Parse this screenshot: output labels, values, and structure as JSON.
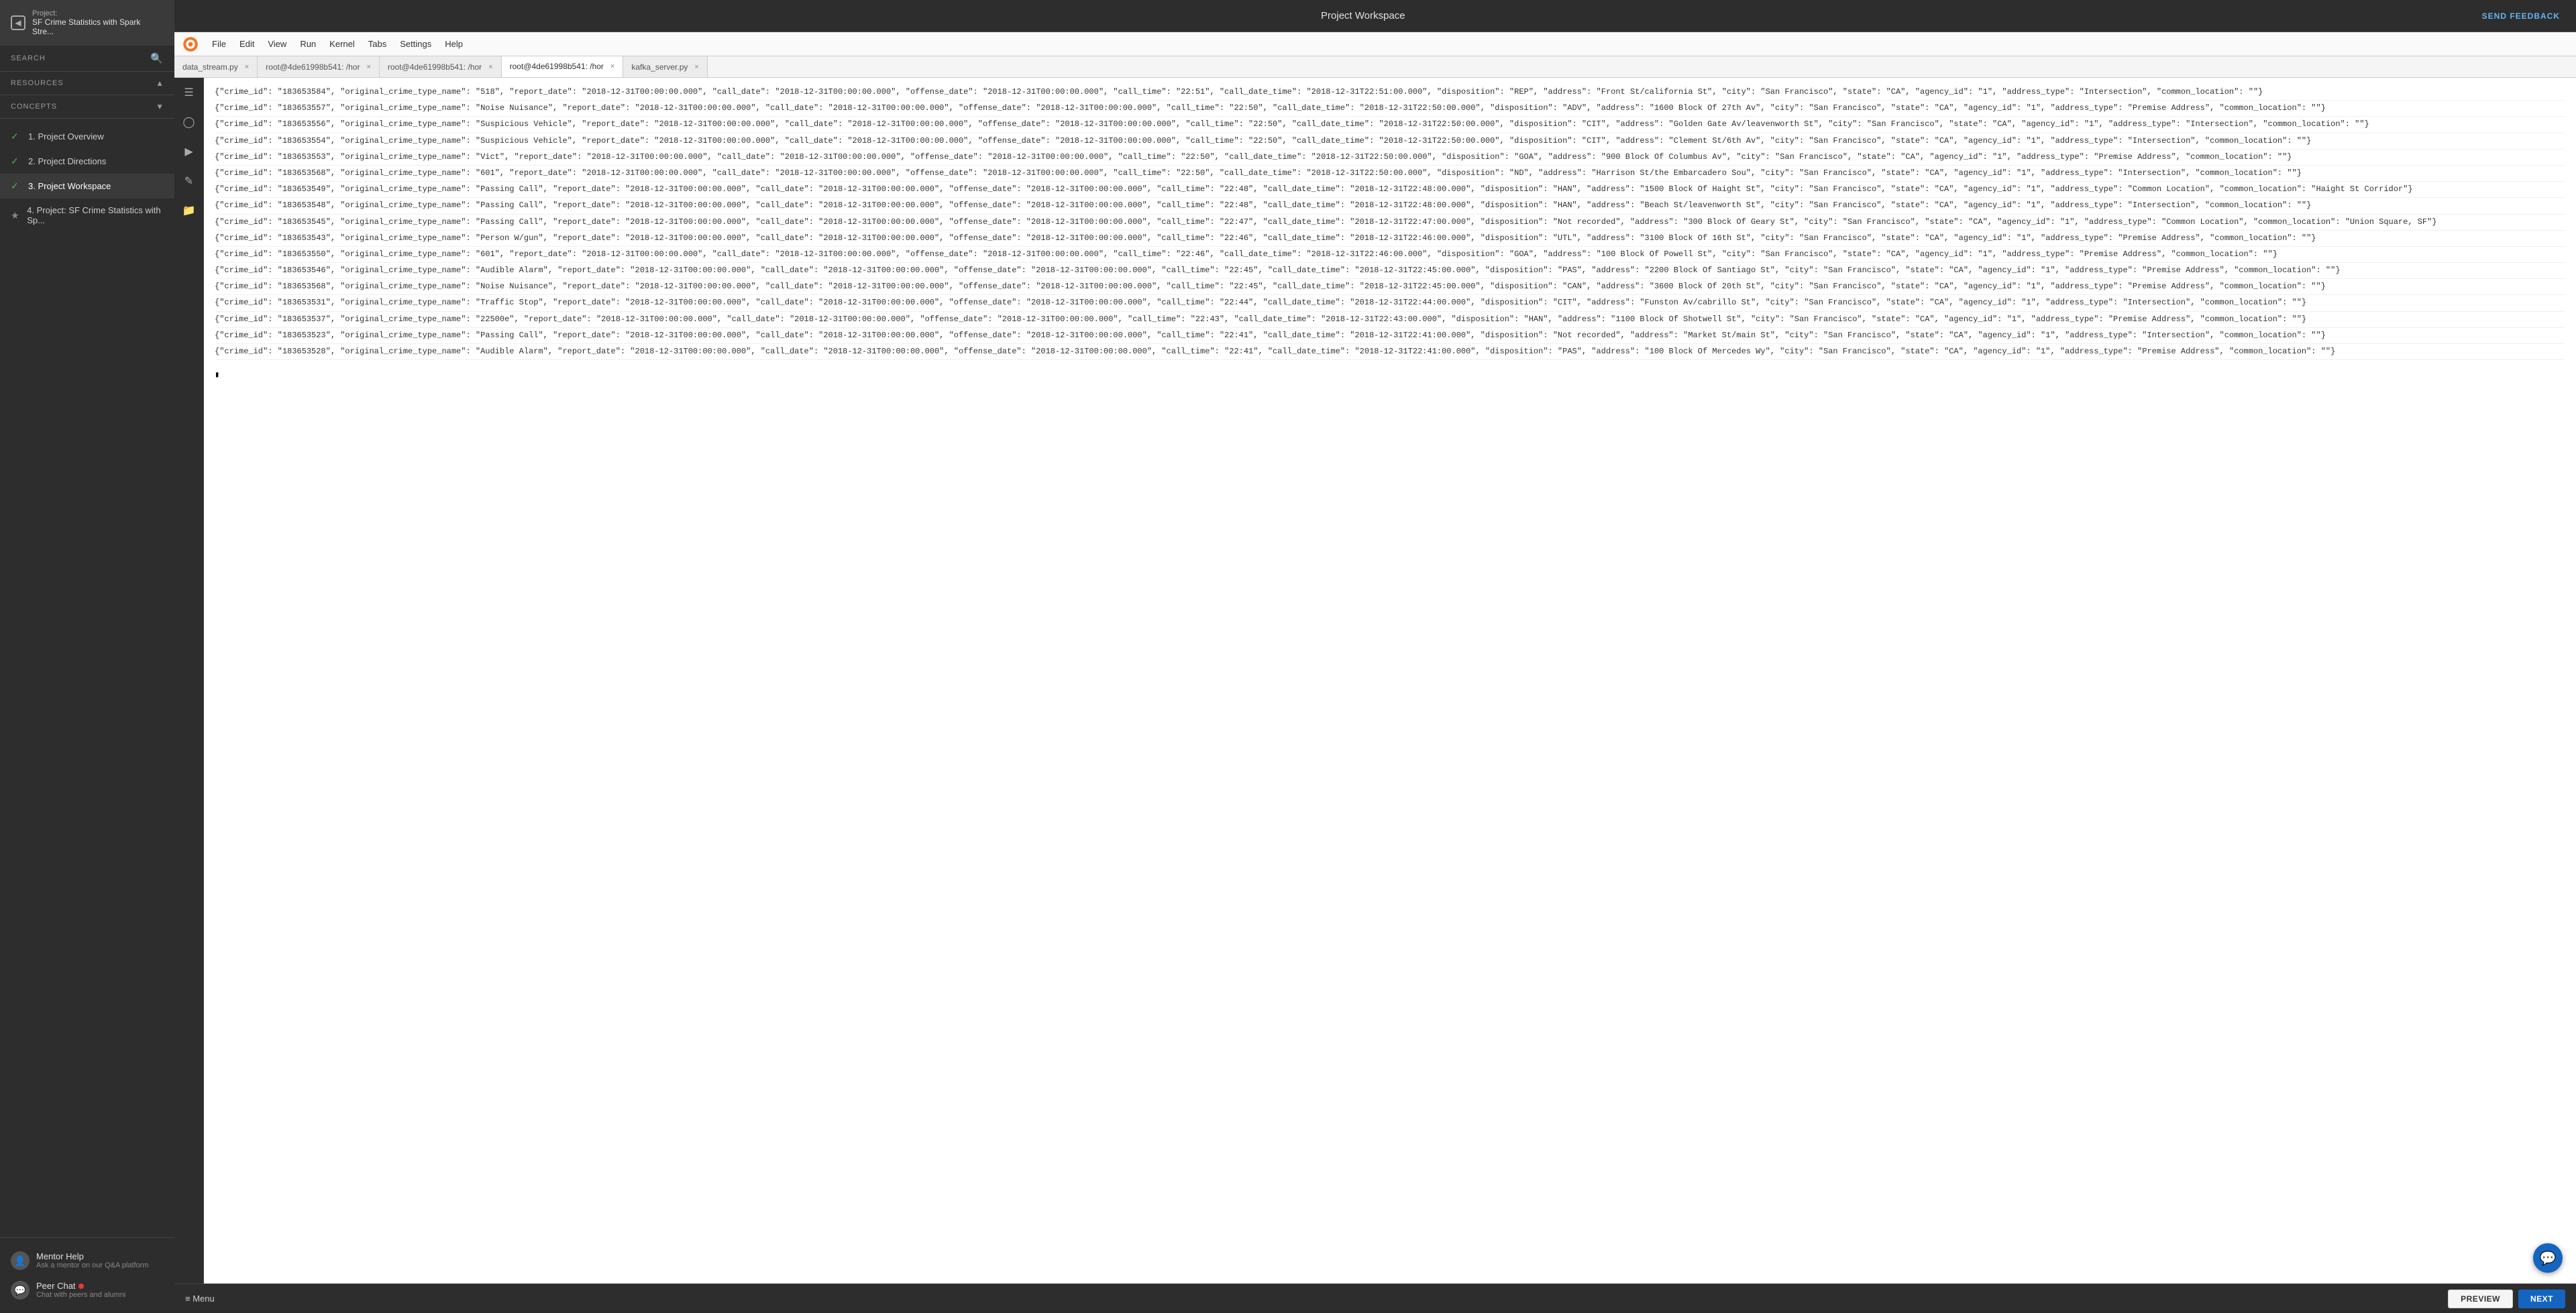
{
  "sidebar": {
    "project_label": "Project:",
    "project_name": "SF Crime Statistics with Spark Stre...",
    "search_label": "SEARCH",
    "resources_label": "RESOURCES",
    "concepts_label": "CONCEPTS",
    "nav_items": [
      {
        "id": "1",
        "label": "1. Project Overview",
        "status": "check",
        "active": false
      },
      {
        "id": "2",
        "label": "2. Project Directions",
        "status": "check",
        "active": false
      },
      {
        "id": "3",
        "label": "3. Project Workspace",
        "status": "check",
        "active": true
      },
      {
        "id": "4",
        "label": "4. Project: SF Crime Statistics with Sp...",
        "status": "star",
        "active": false
      }
    ],
    "mentor_help": {
      "title": "Mentor Help",
      "sub": "Ask a mentor on our Q&A platform"
    },
    "peer_chat": {
      "title": "Peer Chat",
      "sub": "Chat with peers and alumni"
    }
  },
  "header": {
    "title": "Project Workspace",
    "feedback_label": "SEND FEEDBACK"
  },
  "jupyter": {
    "menus": [
      "File",
      "Edit",
      "View",
      "Run",
      "Kernel",
      "Tabs",
      "Settings",
      "Help"
    ]
  },
  "tabs": [
    {
      "label": "data_stream.py",
      "active": false
    },
    {
      "label": "root@4de61998b541: /hor",
      "active": false
    },
    {
      "label": "root@4de61998b541: /hor",
      "active": false
    },
    {
      "label": "root@4de61998b541: /hor",
      "active": true
    },
    {
      "label": "kafka_server.py",
      "active": false
    }
  ],
  "output_lines": [
    "{\"crime_id\": \"183653584\", \"original_crime_type_name\": \"518\", \"report_date\": \"2018-12-31T00:00:00.000\", \"call_date\": \"2018-12-31T00:00:00.000\", \"offense_date\": \"2018-12-31T00:00:00.000\", \"call_time\": \"22:51\", \"call_date_time\": \"2018-12-31T22:51:00.000\", \"disposition\": \"REP\", \"address\": \"Front St/california St\", \"city\": \"San Francisco\", \"state\": \"CA\", \"agency_id\": \"1\", \"address_type\": \"Intersection\", \"common_location\": \"\"}",
    "{\"crime_id\": \"183653557\", \"original_crime_type_name\": \"Noise Nuisance\", \"report_date\": \"2018-12-31T00:00:00.000\", \"call_date\": \"2018-12-31T00:00:00.000\", \"offense_date\": \"2018-12-31T00:00:00.000\", \"call_time\": \"22:50\", \"call_date_time\": \"2018-12-31T22:50:00.000\", \"disposition\": \"ADV\", \"address\": \"1600 Block Of 27th Av\", \"city\": \"San Francisco\", \"state\": \"CA\", \"agency_id\": \"1\", \"address_type\": \"Premise Address\", \"common_location\": \"\"}",
    "{\"crime_id\": \"183653556\", \"original_crime_type_name\": \"Suspicious Vehicle\", \"report_date\": \"2018-12-31T00:00:00.000\", \"call_date\": \"2018-12-31T00:00:00.000\", \"offense_date\": \"2018-12-31T00:00:00.000\", \"call_time\": \"22:50\", \"call_date_time\": \"2018-12-31T22:50:00.000\", \"disposition\": \"CIT\", \"address\": \"Golden Gate Av/leavenworth St\", \"city\": \"San Francisco\", \"state\": \"CA\", \"agency_id\": \"1\", \"address_type\": \"Intersection\", \"common_location\": \"\"}",
    "{\"crime_id\": \"183653554\", \"original_crime_type_name\": \"Suspicious Vehicle\", \"report_date\": \"2018-12-31T00:00:00.000\", \"call_date\": \"2018-12-31T00:00:00.000\", \"offense_date\": \"2018-12-31T00:00:00.000\", \"call_time\": \"22:50\", \"call_date_time\": \"2018-12-31T22:50:00.000\", \"disposition\": \"CIT\", \"address\": \"Clement St/6th Av\", \"city\": \"San Francisco\", \"state\": \"CA\", \"agency_id\": \"1\", \"address_type\": \"Intersection\", \"common_location\": \"\"}",
    "{\"crime_id\": \"183653553\", \"original_crime_type_name\": \"Vict\", \"report_date\": \"2018-12-31T00:00:00.000\", \"call_date\": \"2018-12-31T00:00:00.000\", \"offense_date\": \"2018-12-31T00:00:00.000\", \"call_time\": \"22:50\", \"call_date_time\": \"2018-12-31T22:50:00.000\", \"disposition\": \"GOA\", \"address\": \"900 Block Of Columbus Av\", \"city\": \"San Francisco\", \"state\": \"CA\", \"agency_id\": \"1\", \"address_type\": \"Premise Address\", \"common_location\": \"\"}",
    "{\"crime_id\": \"183653568\", \"original_crime_type_name\": \"601\", \"report_date\": \"2018-12-31T00:00:00.000\", \"call_date\": \"2018-12-31T00:00:00.000\", \"offense_date\": \"2018-12-31T00:00:00.000\", \"call_time\": \"22:50\", \"call_date_time\": \"2018-12-31T22:50:00.000\", \"disposition\": \"ND\", \"address\": \"Harrison St/the Embarcadero Sou\", \"city\": \"San Francisco\", \"state\": \"CA\", \"agency_id\": \"1\", \"address_type\": \"Intersection\", \"common_location\": \"\"}",
    "{\"crime_id\": \"183653549\", \"original_crime_type_name\": \"Passing Call\", \"report_date\": \"2018-12-31T00:00:00.000\", \"call_date\": \"2018-12-31T00:00:00.000\", \"offense_date\": \"2018-12-31T00:00:00.000\", \"call_time\": \"22:48\", \"call_date_time\": \"2018-12-31T22:48:00.000\", \"disposition\": \"HAN\", \"address\": \"1500 Block Of Haight St\", \"city\": \"San Francisco\", \"state\": \"CA\", \"agency_id\": \"1\", \"address_type\": \"Common Location\", \"common_location\": \"Haight St Corridor\"}",
    "{\"crime_id\": \"183653548\", \"original_crime_type_name\": \"Passing Call\", \"report_date\": \"2018-12-31T00:00:00.000\", \"call_date\": \"2018-12-31T00:00:00.000\", \"offense_date\": \"2018-12-31T00:00:00.000\", \"call_time\": \"22:48\", \"call_date_time\": \"2018-12-31T22:48:00.000\", \"disposition\": \"HAN\", \"address\": \"Beach St/leavenworth St\", \"city\": \"San Francisco\", \"state\": \"CA\", \"agency_id\": \"1\", \"address_type\": \"Intersection\", \"common_location\": \"\"}",
    "{\"crime_id\": \"183653545\", \"original_crime_type_name\": \"Passing Call\", \"report_date\": \"2018-12-31T00:00:00.000\", \"call_date\": \"2018-12-31T00:00:00.000\", \"offense_date\": \"2018-12-31T00:00:00.000\", \"call_time\": \"22:47\", \"call_date_time\": \"2018-12-31T22:47:00.000\", \"disposition\": \"Not recorded\", \"address\": \"300 Block Of Geary St\", \"city\": \"San Francisco\", \"state\": \"CA\", \"agency_id\": \"1\", \"address_type\": \"Common Location\", \"common_location\": \"Union Square, SF\"}",
    "{\"crime_id\": \"183653543\", \"original_crime_type_name\": \"Person W/gun\", \"report_date\": \"2018-12-31T00:00:00.000\", \"call_date\": \"2018-12-31T00:00:00.000\", \"offense_date\": \"2018-12-31T00:00:00.000\", \"call_time\": \"22:46\", \"call_date_time\": \"2018-12-31T22:46:00.000\", \"disposition\": \"UTL\", \"address\": \"3100 Block Of 16th St\", \"city\": \"San Francisco\", \"state\": \"CA\", \"agency_id\": \"1\", \"address_type\": \"Premise Address\", \"common_location\": \"\"}",
    "{\"crime_id\": \"183653550\", \"original_crime_type_name\": \"601\", \"report_date\": \"2018-12-31T00:00:00.000\", \"call_date\": \"2018-12-31T00:00:00.000\", \"offense_date\": \"2018-12-31T00:00:00.000\", \"call_time\": \"22:46\", \"call_date_time\": \"2018-12-31T22:46:00.000\", \"disposition\": \"GOA\", \"address\": \"100 Block Of Powell St\", \"city\": \"San Francisco\", \"state\": \"CA\", \"agency_id\": \"1\", \"address_type\": \"Premise Address\", \"common_location\": \"\"}",
    "{\"crime_id\": \"183653546\", \"original_crime_type_name\": \"Audible Alarm\", \"report_date\": \"2018-12-31T00:00:00.000\", \"call_date\": \"2018-12-31T00:00:00.000\", \"offense_date\": \"2018-12-31T00:00:00.000\", \"call_time\": \"22:45\", \"call_date_time\": \"2018-12-31T22:45:00.000\", \"disposition\": \"PAS\", \"address\": \"2200 Block Of Santiago St\", \"city\": \"San Francisco\", \"state\": \"CA\", \"agency_id\": \"1\", \"address_type\": \"Premise Address\", \"common_location\": \"\"}",
    "{\"crime_id\": \"183653568\", \"original_crime_type_name\": \"Noise Nuisance\", \"report_date\": \"2018-12-31T00:00:00.000\", \"call_date\": \"2018-12-31T00:00:00.000\", \"offense_date\": \"2018-12-31T00:00:00.000\", \"call_time\": \"22:45\", \"call_date_time\": \"2018-12-31T22:45:00.000\", \"disposition\": \"CAN\", \"address\": \"3600 Block Of 20th St\", \"city\": \"San Francisco\", \"state\": \"CA\", \"agency_id\": \"1\", \"address_type\": \"Premise Address\", \"common_location\": \"\"}",
    "{\"crime_id\": \"183653531\", \"original_crime_type_name\": \"Traffic Stop\", \"report_date\": \"2018-12-31T00:00:00.000\", \"call_date\": \"2018-12-31T00:00:00.000\", \"offense_date\": \"2018-12-31T00:00:00.000\", \"call_time\": \"22:44\", \"call_date_time\": \"2018-12-31T22:44:00.000\", \"disposition\": \"CIT\", \"address\": \"Funston Av/cabrillo St\", \"city\": \"San Francisco\", \"state\": \"CA\", \"agency_id\": \"1\", \"address_type\": \"Intersection\", \"common_location\": \"\"}",
    "{\"crime_id\": \"183653537\", \"original_crime_type_name\": \"22500e\", \"report_date\": \"2018-12-31T00:00:00.000\", \"call_date\": \"2018-12-31T00:00:00.000\", \"offense_date\": \"2018-12-31T00:00:00.000\", \"call_time\": \"22:43\", \"call_date_time\": \"2018-12-31T22:43:00.000\", \"disposition\": \"HAN\", \"address\": \"1100 Block Of Shotwell St\", \"city\": \"San Francisco\", \"state\": \"CA\", \"agency_id\": \"1\", \"address_type\": \"Premise Address\", \"common_location\": \"\"}",
    "{\"crime_id\": \"183653523\", \"original_crime_type_name\": \"Passing Call\", \"report_date\": \"2018-12-31T00:00:00.000\", \"call_date\": \"2018-12-31T00:00:00.000\", \"offense_date\": \"2018-12-31T00:00:00.000\", \"call_time\": \"22:41\", \"call_date_time\": \"2018-12-31T22:41:00.000\", \"disposition\": \"Not recorded\", \"address\": \"Market St/main St\", \"city\": \"San Francisco\", \"state\": \"CA\", \"agency_id\": \"1\", \"address_type\": \"Intersection\", \"common_location\": \"\"}",
    "{\"crime_id\": \"183653528\", \"original_crime_type_name\": \"Audible Alarm\", \"report_date\": \"2018-12-31T00:00:00.000\", \"call_date\": \"2018-12-31T00:00:00.000\", \"offense_date\": \"2018-12-31T00:00:00.000\", \"call_time\": \"22:41\", \"call_date_time\": \"2018-12-31T22:41:00.000\", \"disposition\": \"PAS\", \"address\": \"100 Block Of Mercedes Wy\", \"city\": \"San Francisco\", \"state\": \"CA\", \"agency_id\": \"1\", \"address_type\": \"Premise Address\", \"common_location\": \"\"}"
  ],
  "bottom": {
    "menu_label": "≡ Menu",
    "preview_label": "PREVIEW",
    "next_label": "NEXT"
  }
}
